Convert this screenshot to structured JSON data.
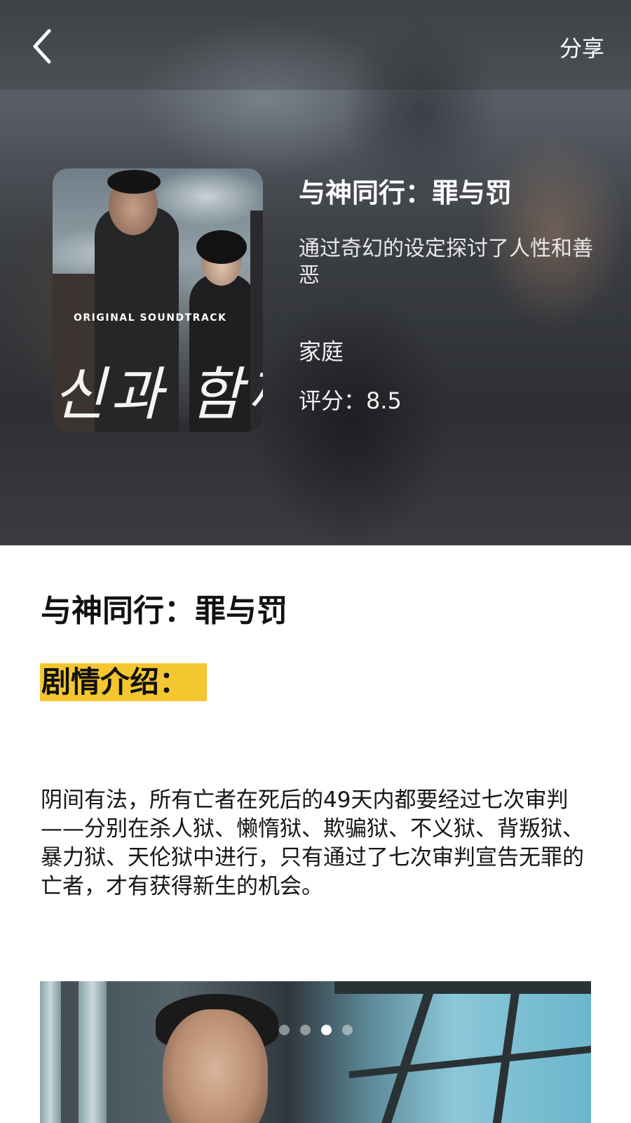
{
  "header": {
    "back_icon": "chevron-left-icon",
    "share_label": "分享"
  },
  "movie": {
    "title": "与神同行：罪与罚",
    "description": "通过奇幻的设定探讨了人性和善恶",
    "genre": "家庭",
    "rating_text": "评分：8.5",
    "poster": {
      "caption": "ORIGINAL SOUNDTRACK",
      "calligraphy": "신과 함께"
    }
  },
  "content": {
    "section_title": "与神同行：罪与罚",
    "plot_label": "剧情介绍：",
    "plot_text": "阴间有法，所有亡者在死后的49天内都要经过七次审判——分别在杀人狱、懒惰狱、欺骗狱、不义狱、背叛狱、暴力狱、天伦狱中进行，只有通过了七次审判宣告无罪的亡者，才有获得新生的机会。",
    "highlight_color": "#f4c630"
  },
  "carousel": {
    "dot_count": 4,
    "active_index": 2
  }
}
